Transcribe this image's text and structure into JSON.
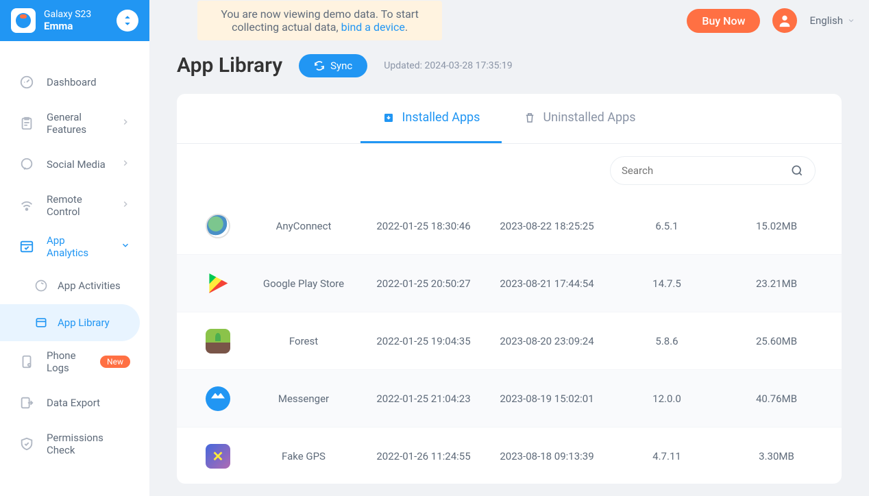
{
  "header": {
    "device_name": "Galaxy S23",
    "profile_name": "Emma"
  },
  "topbar": {
    "demo_text_1": "You are now viewing demo data. To start collecting actual data, ",
    "demo_link": "bind a device",
    "demo_text_2": ".",
    "buy_label": "Buy Now",
    "language": "English"
  },
  "sidebar": {
    "items": [
      {
        "label": "Dashboard",
        "icon": "dashboard"
      },
      {
        "label": "General Features",
        "icon": "clipboard",
        "expand": true
      },
      {
        "label": "Social Media",
        "icon": "chat",
        "expand": true
      },
      {
        "label": "Remote Control",
        "icon": "wifi",
        "expand": true
      },
      {
        "label": "App Analytics",
        "icon": "apps",
        "expand": true,
        "active": true
      },
      {
        "label": "Phone Logs",
        "icon": "phone-log",
        "badge": "New"
      },
      {
        "label": "Data Export",
        "icon": "export"
      },
      {
        "label": "Permissions Check",
        "icon": "shield"
      }
    ],
    "subitems": [
      {
        "label": "App Activities"
      },
      {
        "label": "App Library",
        "active": true
      }
    ]
  },
  "page": {
    "title": "App Library",
    "sync_label": "Sync",
    "updated_prefix": "Updated: ",
    "updated_time": "2024-03-28 17:35:19"
  },
  "tabs": {
    "installed": "Installed Apps",
    "uninstalled": "Uninstalled Apps"
  },
  "search": {
    "placeholder": "Search"
  },
  "apps": [
    {
      "name": "AnyConnect",
      "install": "2022-01-25 18:30:46",
      "update": "2023-08-22 18:25:25",
      "version": "6.5.1",
      "size": "15.02MB",
      "icon": "ic-anyconnect"
    },
    {
      "name": "Google Play Store",
      "install": "2022-01-25 20:50:27",
      "update": "2023-08-21 17:44:54",
      "version": "14.7.5",
      "size": "23.21MB",
      "icon": "ic-playstore"
    },
    {
      "name": "Forest",
      "install": "2022-01-25 19:04:35",
      "update": "2023-08-20 23:09:24",
      "version": "5.8.6",
      "size": "25.60MB",
      "icon": "ic-forest"
    },
    {
      "name": "Messenger",
      "install": "2022-01-25 21:04:23",
      "update": "2023-08-19 15:02:01",
      "version": "12.0.0",
      "size": "40.76MB",
      "icon": "ic-messenger"
    },
    {
      "name": "Fake GPS",
      "install": "2022-01-26 11:24:55",
      "update": "2023-08-18 09:13:39",
      "version": "4.7.11",
      "size": "3.30MB",
      "icon": "ic-fakegps"
    }
  ]
}
